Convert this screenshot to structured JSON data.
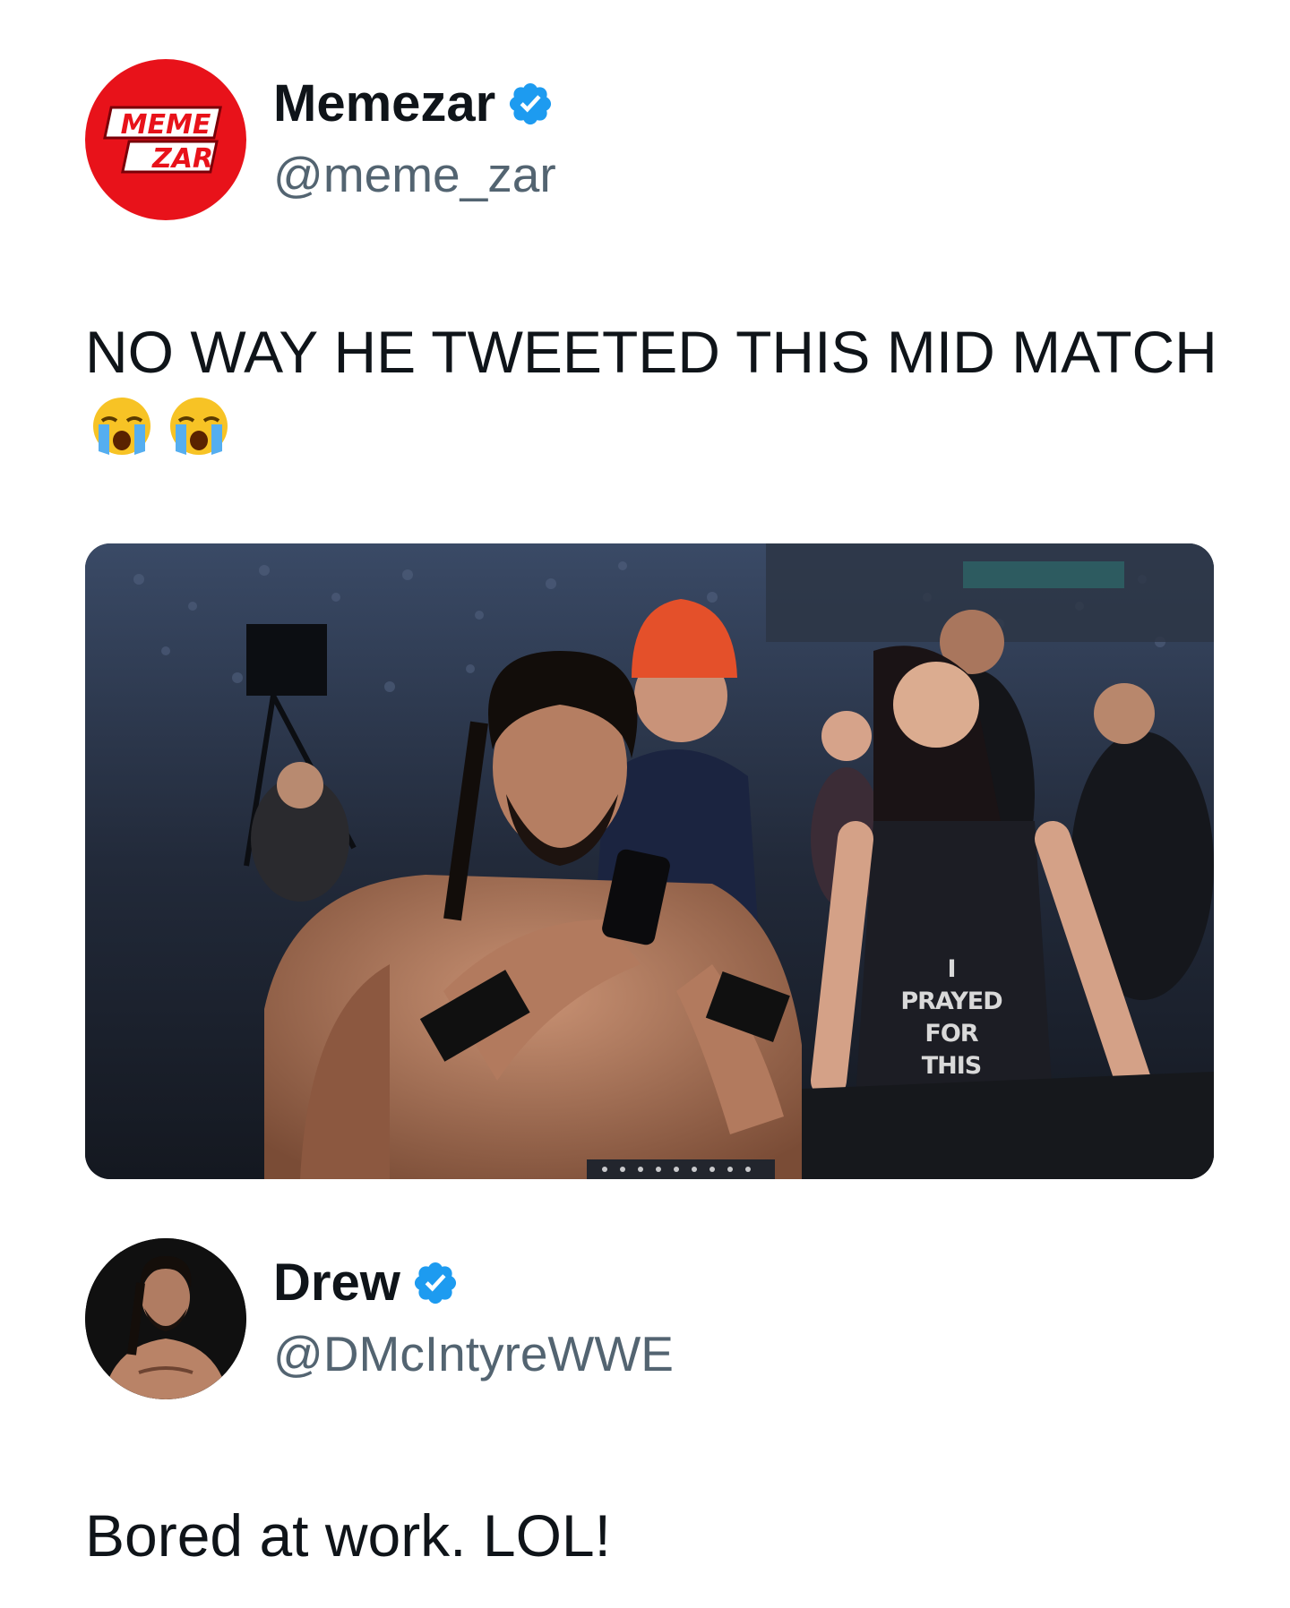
{
  "tweets": [
    {
      "author": {
        "display_name": "Memezar",
        "handle": "@meme_zar",
        "verified": true,
        "avatar": {
          "icon": "memezar-logo",
          "logo_lines": [
            "MEME",
            "ZAR"
          ],
          "color": "#e8121a"
        }
      },
      "text": "NO WAY HE TWEETED THIS MID MATCH",
      "emojis": [
        "loudly-crying-face",
        "loudly-crying-face"
      ],
      "media": {
        "type": "photo",
        "shirt_text": [
          "I PRAYED",
          "FOR THIS"
        ]
      }
    },
    {
      "author": {
        "display_name": "Drew",
        "handle": "@DMcIntyreWWE",
        "verified": true,
        "avatar": {
          "icon": "profile-photo"
        }
      },
      "text": "Bored at work. LOL!"
    }
  ],
  "colors": {
    "verified": "#1d9bf0",
    "handle": "#536471",
    "text": "#0f1419"
  }
}
